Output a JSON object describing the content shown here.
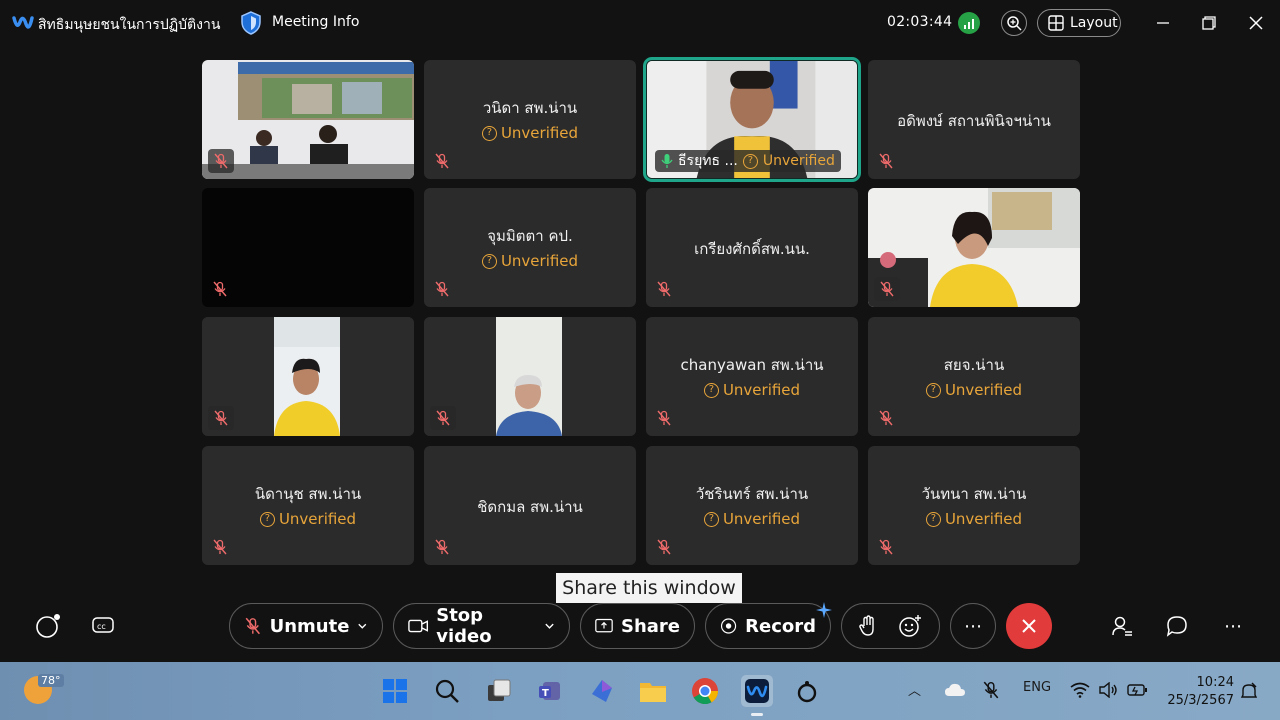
{
  "window": {
    "meeting_name": "สิทธิมนุษยชนในการปฏิบัติงาน",
    "meeting_info_label": "Meeting Info",
    "timer": "02:03:44",
    "layout_label": "Layout"
  },
  "participants": [
    {
      "name": "",
      "status": "",
      "video": "room"
    },
    {
      "name": "วนิดา สพ.น่าน",
      "status": "Unverified"
    },
    {
      "name": "ธีรยุทธ ...",
      "status": "Unverified",
      "video": "speaker",
      "active": true
    },
    {
      "name": "อดิพงษ์ สถานพินิจฯน่าน",
      "status": ""
    },
    {
      "name": "",
      "status": "",
      "video": "black"
    },
    {
      "name": "จุมมิตตา คป.",
      "status": "Unverified"
    },
    {
      "name": "เกรียงศักดิ์สพ.นน.",
      "status": ""
    },
    {
      "name": "",
      "status": "",
      "video": "woman"
    },
    {
      "name": "",
      "status": "",
      "video": "man-yellow"
    },
    {
      "name": "",
      "status": "",
      "video": "man-blue"
    },
    {
      "name": "chanyawan สพ.น่าน",
      "status": "Unverified"
    },
    {
      "name": "สยจ.น่าน",
      "status": "Unverified"
    },
    {
      "name": "นิดานุช สพ.น่าน",
      "status": "Unverified"
    },
    {
      "name": "ชิดกมล สพ.น่าน",
      "status": ""
    },
    {
      "name": "วัชรินทร์ สพ.น่าน",
      "status": "Unverified"
    },
    {
      "name": "วันทนา สพ.น่าน",
      "status": "Unverified"
    }
  ],
  "tooltip": "Share this window",
  "controls": {
    "unmute": "Unmute",
    "stop_video": "Stop video",
    "share": "Share",
    "record": "Record"
  },
  "taskbar": {
    "temperature": "78°",
    "language": "ENG",
    "time": "10:24",
    "date": "25/3/2567"
  },
  "colors": {
    "unverified": "#e8a53a",
    "active_border": "#1fa58a",
    "end_call": "#e23b3b",
    "signal": "#26a146"
  }
}
